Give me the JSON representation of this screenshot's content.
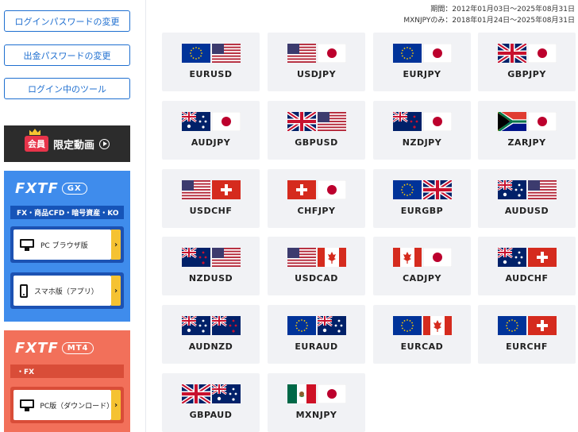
{
  "sidebar": {
    "buttons": [
      {
        "label": "ログインパスワードの変更"
      },
      {
        "label": "出金パスワードの変更"
      },
      {
        "label": "ログイン中のツール"
      }
    ],
    "member_banner": {
      "badge": "会員",
      "label": "限定動画",
      "icon": "play-circle-icon"
    },
    "gx_panel": {
      "logo": "FXTF",
      "logo_suffix": "GX",
      "strip": "FX・商品CFD・暗号資産・KO",
      "pc_label": "PC ブラウザ版",
      "app_label": "スマホ版（アプリ）",
      "color": "#3f8cec"
    },
    "mt4_panel": {
      "logo": "FXTF",
      "logo_suffix": "MT4",
      "strip": "・FX",
      "pc_label": "PC版（ダウンロード）",
      "color": "#f2705a"
    }
  },
  "period": {
    "line1": "期間：2012年01月03日～2025年08月31日",
    "line2": "MXNJPYのみ：2018年01月24日～2025年08月31日"
  },
  "pairs": [
    {
      "name": "EURUSD",
      "flags": [
        "eu",
        "us"
      ]
    },
    {
      "name": "USDJPY",
      "flags": [
        "us",
        "jp"
      ]
    },
    {
      "name": "EURJPY",
      "flags": [
        "eu",
        "jp"
      ]
    },
    {
      "name": "GBPJPY",
      "flags": [
        "gb",
        "jp"
      ]
    },
    {
      "name": "AUDJPY",
      "flags": [
        "au",
        "jp"
      ]
    },
    {
      "name": "GBPUSD",
      "flags": [
        "gb",
        "us"
      ]
    },
    {
      "name": "NZDJPY",
      "flags": [
        "nz",
        "jp"
      ]
    },
    {
      "name": "ZARJPY",
      "flags": [
        "za",
        "jp"
      ]
    },
    {
      "name": "USDCHF",
      "flags": [
        "us",
        "ch"
      ]
    },
    {
      "name": "CHFJPY",
      "flags": [
        "ch",
        "jp"
      ]
    },
    {
      "name": "EURGBP",
      "flags": [
        "eu",
        "gb"
      ]
    },
    {
      "name": "AUDUSD",
      "flags": [
        "au",
        "us"
      ]
    },
    {
      "name": "NZDUSD",
      "flags": [
        "nz",
        "us"
      ]
    },
    {
      "name": "USDCAD",
      "flags": [
        "us",
        "ca"
      ]
    },
    {
      "name": "CADJPY",
      "flags": [
        "ca",
        "jp"
      ]
    },
    {
      "name": "AUDCHF",
      "flags": [
        "au",
        "ch"
      ]
    },
    {
      "name": "AUDNZD",
      "flags": [
        "au",
        "nz"
      ]
    },
    {
      "name": "EURAUD",
      "flags": [
        "eu",
        "au"
      ]
    },
    {
      "name": "EURCAD",
      "flags": [
        "eu",
        "ca"
      ]
    },
    {
      "name": "EURCHF",
      "flags": [
        "eu",
        "ch"
      ]
    },
    {
      "name": "GBPAUD",
      "flags": [
        "gb",
        "au"
      ]
    },
    {
      "name": "MXNJPY",
      "flags": [
        "mx",
        "jp"
      ]
    }
  ]
}
